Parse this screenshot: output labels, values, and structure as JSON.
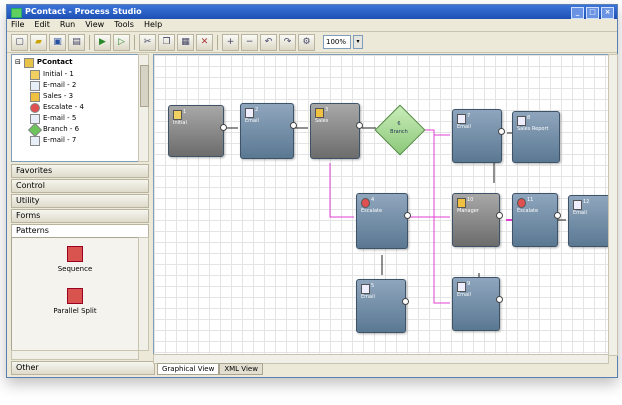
{
  "window": {
    "title": "PContact - Process Studio"
  },
  "menu": [
    "File",
    "Edit",
    "Run",
    "View",
    "Tools",
    "Help"
  ],
  "toolbar": {
    "zoom_value": "100%"
  },
  "tree": {
    "root": "PContact",
    "items": [
      {
        "label": "Initial - 1",
        "icon": "initial-icon"
      },
      {
        "label": "E-mail - 2",
        "icon": "email-icon"
      },
      {
        "label": "Sales - 3",
        "icon": "sales-icon"
      },
      {
        "label": "Escalate - 4",
        "icon": "escalate-icon"
      },
      {
        "label": "E-mail - 5",
        "icon": "email-icon"
      },
      {
        "label": "Branch - 6",
        "icon": "branch-icon"
      },
      {
        "label": "E-mail - 7",
        "icon": "email-icon"
      }
    ]
  },
  "sections": [
    "Favorites",
    "Control",
    "Utility",
    "Forms",
    "Patterns"
  ],
  "patterns": [
    {
      "label": "Sequence",
      "icon": "sequence-pattern-icon"
    },
    {
      "label": "Parallel Split",
      "icon": "parallel-split-pattern-icon"
    }
  ],
  "other_section": "Other",
  "view_tabs": [
    "Graphical View",
    "XML View"
  ],
  "diagram": {
    "nodes": [
      {
        "num": "1",
        "label": "Initial"
      },
      {
        "num": "2",
        "label": "Email"
      },
      {
        "num": "3",
        "label": "Sales"
      },
      {
        "num": "6",
        "label": "Branch"
      },
      {
        "num": "7",
        "label": "Email"
      },
      {
        "num": "8",
        "label": "Sales Report"
      },
      {
        "num": "4",
        "label": "Escalate"
      },
      {
        "num": "10",
        "label": "Manager"
      },
      {
        "num": "11",
        "label": "Escalate"
      },
      {
        "num": "12",
        "label": "Email"
      },
      {
        "num": "5",
        "label": "Email"
      },
      {
        "num": "9",
        "label": "Email"
      }
    ]
  }
}
